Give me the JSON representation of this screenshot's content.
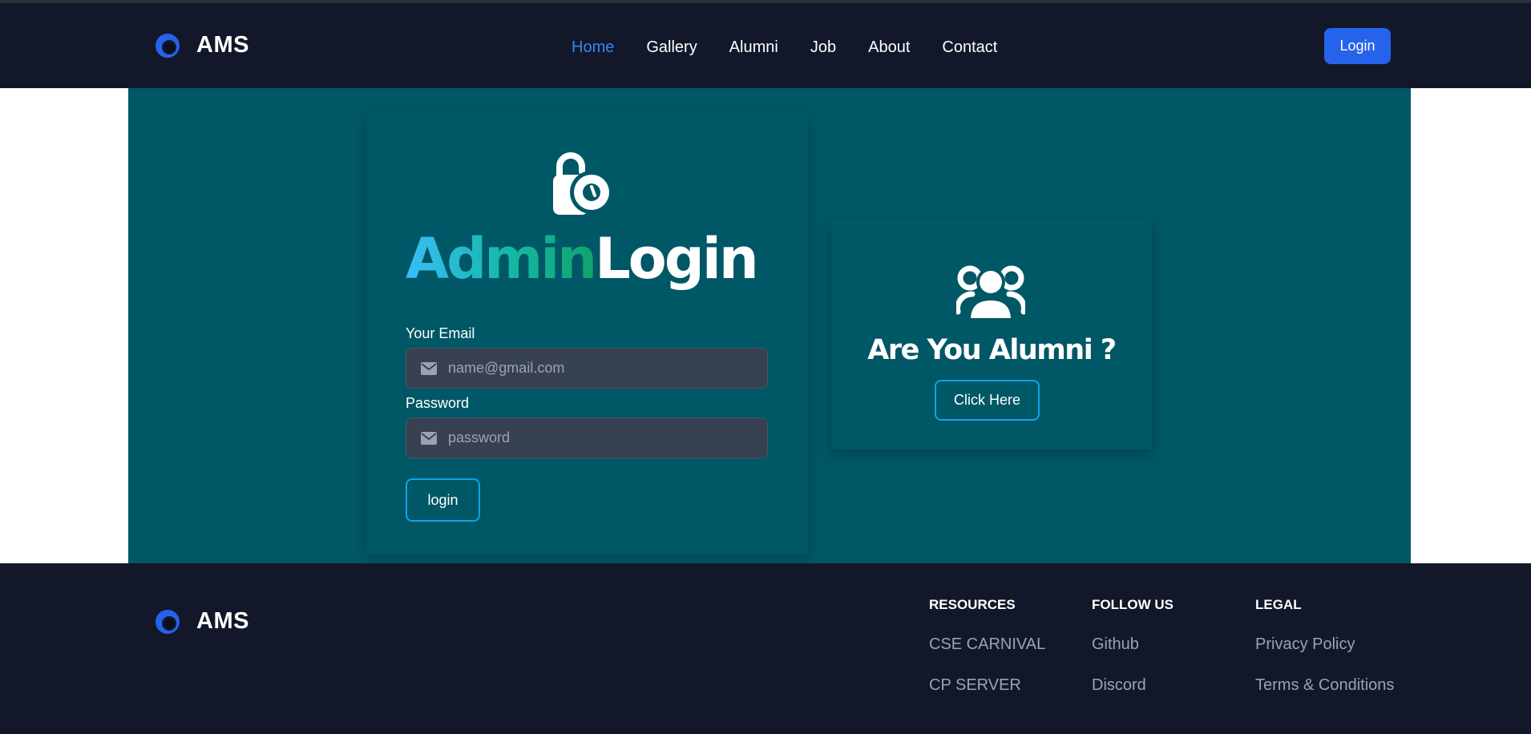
{
  "brand": {
    "name": "AMS"
  },
  "nav": {
    "links": [
      {
        "label": "Home",
        "active": true
      },
      {
        "label": "Gallery",
        "active": false
      },
      {
        "label": "Alumni",
        "active": false
      },
      {
        "label": "Job",
        "active": false
      },
      {
        "label": "About",
        "active": false
      },
      {
        "label": "Contact",
        "active": false
      }
    ],
    "login_label": "Login"
  },
  "login_form": {
    "title_part1": "Admin",
    "title_part2": "Login",
    "email_label": "Your Email",
    "email_placeholder": "name@gmail.com",
    "password_label": "Password",
    "password_placeholder": "password",
    "submit_label": "login"
  },
  "alumni_card": {
    "title": "Are You Alumni ?",
    "button_label": "Click Here"
  },
  "footer": {
    "brand": "AMS",
    "columns": [
      {
        "heading": "RESOURCES",
        "links": [
          "CSE CARNIVAL",
          "CP SERVER"
        ]
      },
      {
        "heading": "FOLLOW US",
        "links": [
          "Github",
          "Discord"
        ]
      },
      {
        "heading": "LEGAL",
        "links": [
          "Privacy Policy",
          "Terms & Conditions"
        ]
      }
    ]
  },
  "colors": {
    "nav_bg": "#121829",
    "hero_bg": "#005766",
    "accent_blue": "#2563eb",
    "active_link": "#3b82f6",
    "button_border": "#0ea5e9"
  },
  "icons": {
    "brand_logo": "ring-logo-icon",
    "form_header": "unlock-icon",
    "input_prefix": "mail-icon",
    "alumni_header": "users-icon"
  }
}
